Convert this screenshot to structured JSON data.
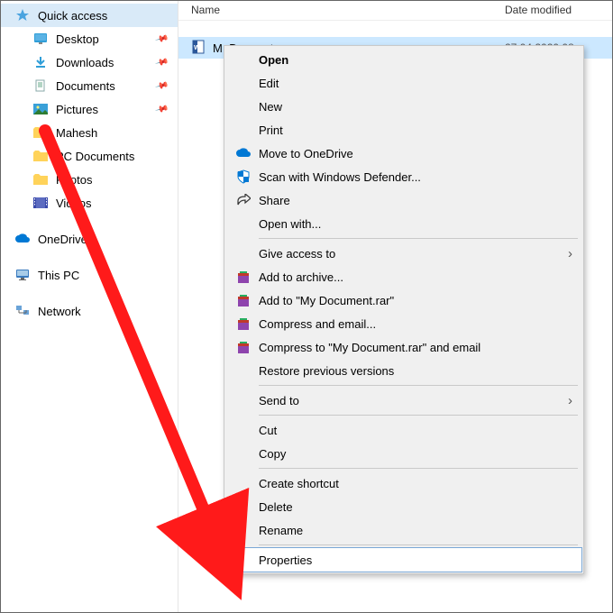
{
  "columns": {
    "name": "Name",
    "date": "Date modified"
  },
  "sidebar": {
    "quick_access": "Quick access",
    "items": [
      {
        "label": "Desktop"
      },
      {
        "label": "Downloads"
      },
      {
        "label": "Documents"
      },
      {
        "label": "Pictures"
      },
      {
        "label": "Mahesh"
      },
      {
        "label": "PC Documents"
      },
      {
        "label": "Photos"
      },
      {
        "label": "Videos"
      }
    ],
    "onedrive": "OneDrive",
    "thispc": "This PC",
    "network": "Network"
  },
  "file": {
    "name_partial_1": "M",
    "name_partial_2": "D",
    "name_partial_3": "t",
    "date_partial": "27 04 2020 08:"
  },
  "menu": {
    "open": "Open",
    "edit": "Edit",
    "new": "New",
    "print": "Print",
    "onedrive": "Move to OneDrive",
    "defender": "Scan with Windows Defender...",
    "share": "Share",
    "openwith": "Open with...",
    "giveaccess": "Give access to",
    "addarchive": "Add to archive...",
    "addto": "Add to \"My Document.rar\"",
    "compress": "Compress and email...",
    "compressto": "Compress to \"My Document.rar\" and email",
    "restore": "Restore previous versions",
    "sendto": "Send to",
    "cut": "Cut",
    "copy": "Copy",
    "shortcut": "Create shortcut",
    "delete": "Delete",
    "rename": "Rename",
    "properties": "Properties"
  }
}
